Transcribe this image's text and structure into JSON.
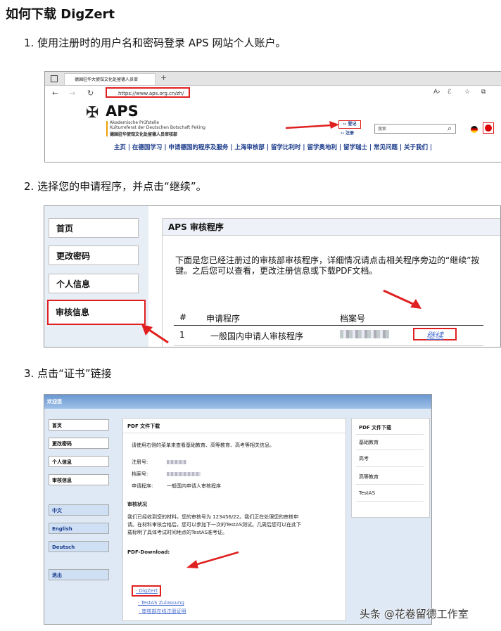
{
  "title": "如何下载 DigZert",
  "steps": [
    "1.  使用注册时的用户名和密码登录 APS 网站个人账户。",
    "2.  选择您的申请程序，并点击“继续”。",
    "3.  点击“证书”链接"
  ],
  "shot1": {
    "tab_title": "德国驻华大使馆文化处留德人员审",
    "url": "https://www.aps.org.cn/zh/",
    "logo": "APS",
    "subtitle1": "Akademische Prüfstelle",
    "subtitle2": "Kulturreferat der Deutschen Botschaft Peking",
    "subtitle3": "德国驻华使馆文化处留德人员审核部",
    "login": "›› 登记",
    "register": "›› 注册",
    "search_placeholder": "搜索",
    "menu": "主页 | 在德国学习 | 申请德国的程序及服务 | 上海审核部 | 留学比利时 | 留学奥地利 | 留学瑞士 | 常见问题 | 关于我们 |"
  },
  "shot2": {
    "nav": [
      "首页",
      "更改密码",
      "个人信息",
      "审核信息"
    ],
    "panel_title": "APS 审核程序",
    "text": "下面是您已经注册过的审核部审核程序，详细情况请点击相关程序旁边的“继续”按键。之后您可以查看，更改注册信息或下载PDF文档。",
    "col_num": "#",
    "col_program": "申请程序",
    "col_file": "档案号",
    "row_num": "1",
    "row_program": "一般国内申请人审核程序",
    "continue": "继续"
  },
  "shot3": {
    "welcome": "欢迎您",
    "side": [
      "首页",
      "更改密码",
      "个人信息",
      "审核信息"
    ],
    "langs": [
      "中文",
      "English",
      "Deutsch"
    ],
    "logout": "退出",
    "panel_title": "PDF 文件下载",
    "intro": "请使用右侧的菜单来查看基础教育、高等教育、高考等相关信息。",
    "reg_label": "注册号:",
    "file_label": "档案号:",
    "program_label": "申请程序:",
    "program_value": "一般国内申请人审核程序",
    "status_title": "审核状况",
    "status_text1": "我们已经收到您的材料。您的审核号为 123456/22。我们正在处理您的审核申",
    "status_text2": "请。在材料审核合格后，您可以参加下一次的TestAS测试。几周后您可以在此下",
    "status_text3": "载标明了具体考试时间地点的TestAS准考证。",
    "pdf_title": "PDF-Download:",
    "links": [
      "· DigZert",
      "· 审核部在线注册证明",
      "· TestAS Zulassung"
    ],
    "right_title": "PDF 文件下载",
    "right_items": [
      "基础教育",
      "高考",
      "高等教育",
      "TestAS"
    ]
  },
  "watermark": "头条 @花卷留德工作室"
}
